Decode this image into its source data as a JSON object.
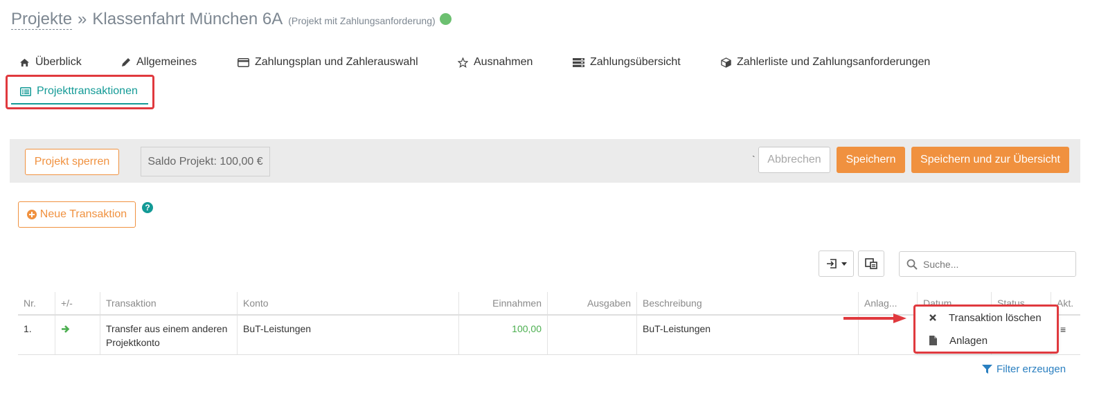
{
  "title": {
    "link": "Projekte",
    "separator": "»",
    "name": "Klassenfahrt München 6A",
    "subtitle": "(Projekt mit Zahlungsanforderung)",
    "status_color": "#6cc070"
  },
  "tabs": [
    {
      "label": "Überblick",
      "icon": "home-icon"
    },
    {
      "label": "Allgemeines",
      "icon": "pencil-icon"
    },
    {
      "label": "Zahlungsplan und Zahlerauswahl",
      "icon": "credit-card-icon"
    },
    {
      "label": "Ausnahmen",
      "icon": "star-icon"
    },
    {
      "label": "Zahlungsübersicht",
      "icon": "server-icon"
    },
    {
      "label": "Zahlerliste und Zahlungsanforderungen",
      "icon": "cube-icon"
    },
    {
      "label": "Projekttransaktionen",
      "icon": "list-alt-icon",
      "active": true
    }
  ],
  "action_bar": {
    "lock_button": "Projekt sperren",
    "saldo": "Saldo Projekt: 100,00 €",
    "tick": "`",
    "cancel_button": "Abbrechen",
    "save_button": "Speichern",
    "save_overview_button": "Speichern und zur Übersicht"
  },
  "new_transaction_button": "Neue Transaktion",
  "help_glyph": "?",
  "search": {
    "placeholder": "Suche..."
  },
  "table": {
    "headers": [
      "Nr.",
      "+/-",
      "Transaktion",
      "Konto",
      "Einnahmen",
      "Ausgaben",
      "Beschreibung",
      "Anlag...",
      "Datum",
      "Status",
      "Akt."
    ],
    "rows": [
      {
        "nr": "1.",
        "transaktion_line1": "Transfer aus einem anderen",
        "transaktion_line2": "Projektkonto",
        "konto": "BuT-Leistungen",
        "einnahmen": "100,00",
        "ausgaben": "",
        "beschreibung": "BuT-Leistungen"
      }
    ]
  },
  "row_menu": {
    "delete": "Transaktion löschen",
    "attachments": "Anlagen"
  },
  "filter_link": "Filter erzeugen",
  "colors": {
    "accent_teal": "#139a96",
    "orange": "#f0913f",
    "highlight_red": "#e0393e",
    "link_blue": "#2a7fc0"
  }
}
